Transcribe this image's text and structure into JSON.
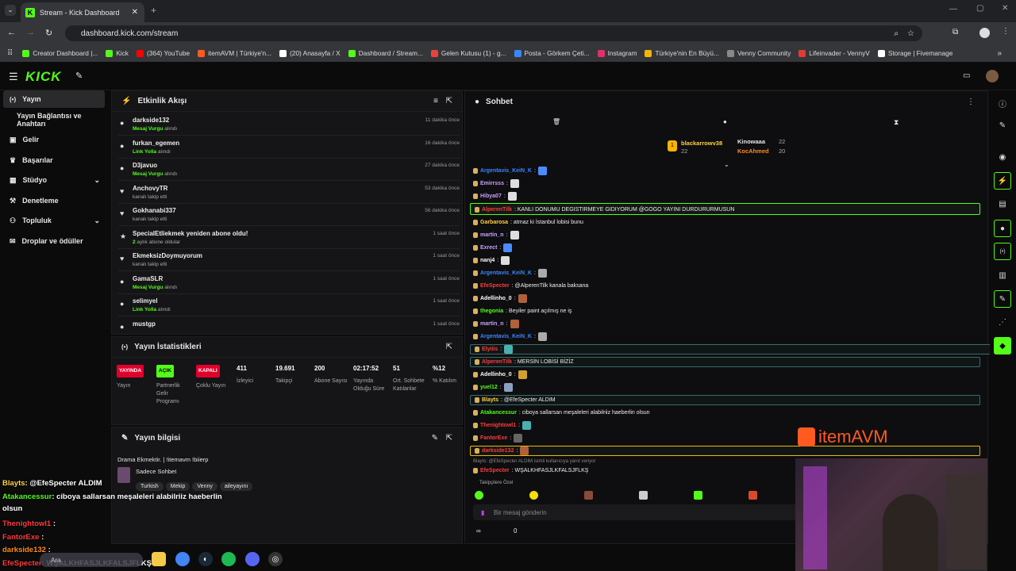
{
  "browser": {
    "tab_title": "Stream - Kick Dashboard",
    "url": "dashboard.kick.com/stream",
    "bookmarks": [
      {
        "label": "Creator Dashboard |...",
        "color": "#53fc18"
      },
      {
        "label": "Kick",
        "color": "#53fc18"
      },
      {
        "label": "(364) YouTube",
        "color": "#ff0000"
      },
      {
        "label": "itemAVM | Türkiye'n...",
        "color": "#ff5a1f"
      },
      {
        "label": "(20) Anasayfa / X",
        "color": "#ffffff"
      },
      {
        "label": "Dashboard / Stream...",
        "color": "#53fc18"
      },
      {
        "label": "Gelen Kutusu (1) - g...",
        "color": "#ea4335"
      },
      {
        "label": "Posta - Görkem Çeti...",
        "color": "#3a86ff"
      },
      {
        "label": "Instagram",
        "color": "#e1306c"
      },
      {
        "label": "Türkiye'nin En Büyü...",
        "color": "#f7b500"
      },
      {
        "label": "Venny Community",
        "color": "#888888"
      },
      {
        "label": "Lifeinvader - VennyV",
        "color": "#e53935"
      },
      {
        "label": "Storage | Fivemanage",
        "color": "#ffffff"
      }
    ]
  },
  "header": {
    "logo": "KICK"
  },
  "sidebar": {
    "items": [
      {
        "label": "Yayın",
        "icon": "broadcast-icon"
      },
      {
        "label": "Yayın Bağlantısı ve Anahtarı",
        "icon": ""
      },
      {
        "label": "Gelir",
        "icon": "wallet-icon"
      },
      {
        "label": "Başarılar",
        "icon": "trophy-icon"
      },
      {
        "label": "Stüdyo",
        "icon": "studio-icon"
      },
      {
        "label": "Denetleme",
        "icon": "hammer-icon"
      },
      {
        "label": "Topluluk",
        "icon": "community-icon"
      },
      {
        "label": "Droplar ve ödüller",
        "icon": "gift-icon"
      }
    ]
  },
  "activity": {
    "title": "Etkinlik Akışı",
    "events": [
      {
        "name": "darkside132",
        "sub_hl": "Mesaj Vurgu",
        "sub": " alındı",
        "time": "11 dakika önce",
        "icon": "●"
      },
      {
        "name": "furkan_egemen",
        "sub_hl": "Link Yolla",
        "sub": " alındı",
        "time": "16 dakika önce",
        "icon": "●"
      },
      {
        "name": "D3javuo",
        "sub_hl": "Mesaj Vurgu",
        "sub": " alındı",
        "time": "27 dakika önce",
        "icon": "●"
      },
      {
        "name": "AnchovyTR",
        "sub_hl": "",
        "sub": "kanalı takip etti",
        "time": "53 dakika önce",
        "icon": "♥"
      },
      {
        "name": "Gokhanabi337",
        "sub_hl": "",
        "sub": "kanalı takip etti",
        "time": "56 dakika önce",
        "icon": "♥"
      },
      {
        "name": "SpecialEtliekmek yeniden abone oldu!",
        "sub_hl": "2",
        "sub": " aylık abone oldular",
        "time": "1 saat önce",
        "icon": "★"
      },
      {
        "name": "EkmeksizDoymuyorum",
        "sub_hl": "",
        "sub": "kanalı takip etti",
        "time": "1 saat önce",
        "icon": "♥"
      },
      {
        "name": "GamaSLR",
        "sub_hl": "Mesaj Vurgu",
        "sub": " alındı",
        "time": "1 saat önce",
        "icon": "●"
      },
      {
        "name": "selimyel",
        "sub_hl": "Link Yolla",
        "sub": " alındı",
        "time": "1 saat önce",
        "icon": "●"
      },
      {
        "name": "mustgp",
        "sub_hl": "",
        "sub": "",
        "time": "1 saat önce",
        "icon": "●"
      }
    ]
  },
  "stats": {
    "title": "Yayın İstatistikleri",
    "badges": [
      {
        "badge": "YAYINDA",
        "label": "Yayın",
        "color": "#e0002b"
      },
      {
        "badge": "AÇIK",
        "label": "Partnerlik Gelir Programı",
        "color": "#53fc18"
      },
      {
        "badge": "KAPALI",
        "label": "Çoklu Yayın",
        "color": "#e0002b"
      }
    ],
    "values": [
      {
        "value": "411",
        "label": "İzleyici"
      },
      {
        "value": "19.691",
        "label": "Takipçi"
      },
      {
        "value": "200",
        "label": "Abone Sayısı"
      },
      {
        "value": "02:17:52",
        "label": "Yayında Olduğu Süre"
      },
      {
        "value": "51",
        "label": "Ort. Sohbete Katılanlar"
      },
      {
        "value": "%12",
        "label": "% Katılım"
      }
    ]
  },
  "info": {
    "title": "Yayın bilgisi",
    "stream_title": "Drama Ekmektir. | !itemavm !biierp",
    "category": "Sadece Sohbet",
    "tags": [
      "Turkish",
      "Mekip",
      "Venny",
      "aileyayını"
    ]
  },
  "chat": {
    "title": "Sohbet",
    "top": {
      "first": "blackarrowv38",
      "first_count": "22",
      "second": "Kinowaaa",
      "second_count": "22",
      "third": "KocAhmed",
      "third_count": "20"
    },
    "messages": [
      {
        "user": "Argentavis_KeiN_K",
        "color": "#3a86ff",
        "text": ":"
      },
      {
        "user": "Emirrsss",
        "color": "#c9a0ff",
        "text": ":"
      },
      {
        "user": "Hibya07",
        "color": "#c9a0ff",
        "text": ":"
      },
      {
        "user": "AlperenTilk",
        "color": "#ff3b3b",
        "text": ": KANLI DONUMU DEGISTIRMEYE GIDIYORUM @GOGO YAYINI DURDURURMUSUN"
      },
      {
        "user": "Garbarosa",
        "color": "#ffd23f",
        "text": ": atmaz ki İstanbul lobisi bunu"
      },
      {
        "user": "martin_n",
        "color": "#c9a0ff",
        "text": ":"
      },
      {
        "user": "Exrect",
        "color": "#c9a0ff",
        "text": ":"
      },
      {
        "user": "nanj4",
        "color": "#ffffff",
        "text": ":"
      },
      {
        "user": "Argentavis_KeiN_K",
        "color": "#3a86ff",
        "text": ":"
      },
      {
        "user": "EfeSpecter",
        "color": "#ff3b3b",
        "text": ": @AlperenTilk kanala baksana"
      },
      {
        "user": "Adellinho_0",
        "color": "#ffffff",
        "text": ":"
      },
      {
        "user": "thegonia",
        "color": "#53fc18",
        "text": ": Beyiler paint açılmış ne iş"
      },
      {
        "user": "martin_n",
        "color": "#c9a0ff",
        "text": ":"
      },
      {
        "user": "Argentavis_KeiN_K",
        "color": "#3a86ff",
        "text": ":"
      },
      {
        "user": "Elyiiis",
        "color": "#ff3b3b",
        "text": ":"
      },
      {
        "user": "AlperenTilk",
        "color": "#ff3b3b",
        "text": ": MERSİN LOBİSİ BİZİZ"
      },
      {
        "user": "Adellinho_0",
        "color": "#ffffff",
        "text": ":"
      },
      {
        "user": "yuel12",
        "color": "#53fc18",
        "text": ":"
      },
      {
        "user": "Blayts",
        "color": "#ffd23f",
        "text": ": @EfeSpecter ALDIM"
      },
      {
        "user": "Atakancessur",
        "color": "#53fc18",
        "text": ": ciboya sallarsan meşaleleri alabilriiz haeberlin olsun"
      },
      {
        "user": "Thenightowl1",
        "color": "#ff3b3b",
        "text": ":"
      },
      {
        "user": "FantorExe",
        "color": "#ff3b3b",
        "text": ":"
      },
      {
        "user": "darkside132",
        "color": "#ff3b3b",
        "text": ":"
      },
      {
        "user": "EfeSpecter",
        "color": "#ff3b3b",
        "text": ": WŞALKHFASJLKFALSJFLKŞ"
      }
    ],
    "reply_note": "Blayts: @EfeSpecter ALDIM isimli kullanıcıya yanıt veriyor",
    "follower_label": "Takipçilere Özel",
    "input_placeholder": "Bir mesaj gönderin",
    "count_zero": "0"
  },
  "overlay": {
    "brand": "itemAVM",
    "lines": [
      {
        "user": "Blayts",
        "text": ": @EfeSpecter ALDIM",
        "color": "#ffd23f"
      },
      {
        "user": "Atakancessur",
        "text": ": ciboya sallarsan meşaleleri alabilriiz haeberlin",
        "color": "#53fc18"
      },
      {
        "user": "",
        "text": "olsun",
        "color": "#53fc18"
      },
      {
        "user": "Thenightowl1",
        "text": " :",
        "color": "#ff3b3b"
      },
      {
        "user": "FantorExe",
        "text": " :",
        "color": "#ff3b3b"
      },
      {
        "user": "darkside132",
        "text": " :",
        "color": "#ff8c1a"
      },
      {
        "user": "EfeSpecter",
        "text": ": WŞALKHFASJLKFALSJFLKŞ",
        "color": "#ff3b3b"
      }
    ],
    "search": "Ara"
  }
}
